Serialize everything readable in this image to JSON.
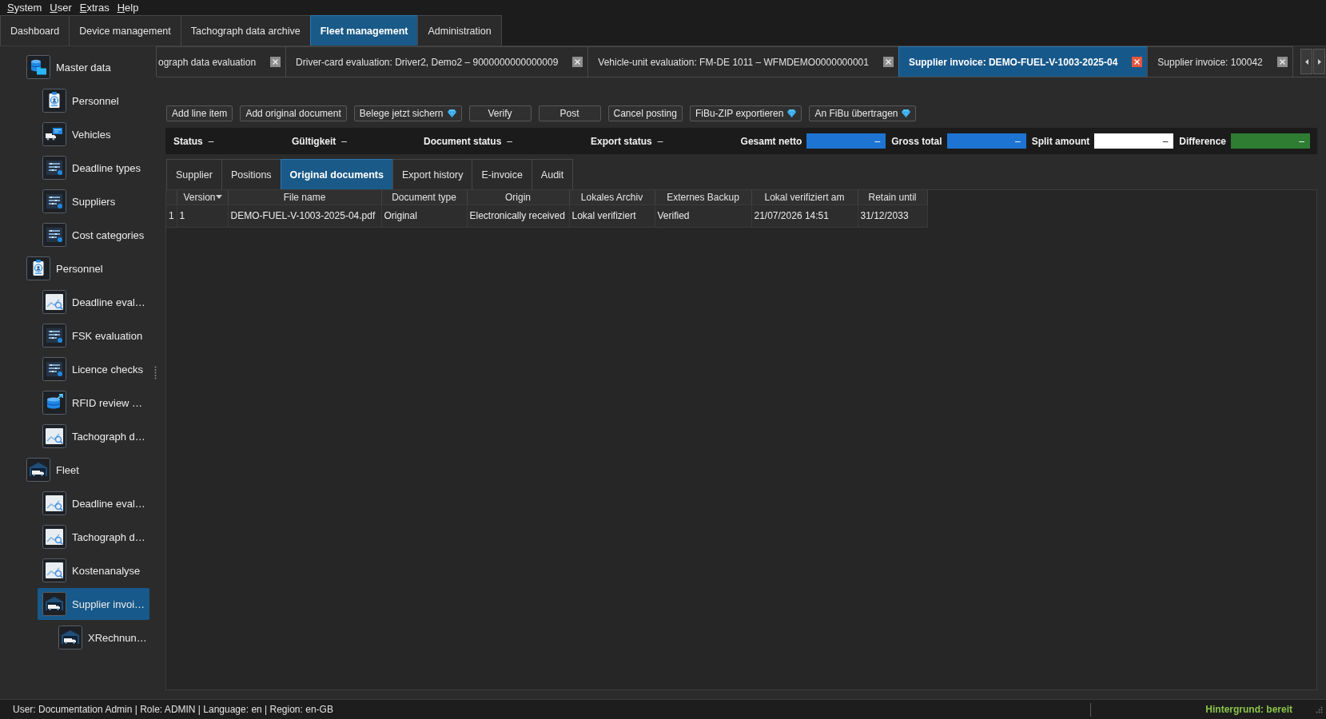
{
  "menu_bar": {
    "items": [
      "System",
      "User",
      "Extras",
      "Help"
    ]
  },
  "main_tabs": [
    {
      "label": "Dashboard",
      "selected": false
    },
    {
      "label": "Device management",
      "selected": false
    },
    {
      "label": "Tachograph data archive",
      "selected": false
    },
    {
      "label": "Fleet management",
      "selected": true
    },
    {
      "label": "Administration",
      "selected": false
    }
  ],
  "sidebar": {
    "items": [
      {
        "label": "Master data",
        "kind": "database",
        "selected": false,
        "children": [
          {
            "label": "Personnel",
            "kind": "badge",
            "selected": false
          },
          {
            "label": "Vehicles",
            "kind": "vehicles",
            "selected": false
          },
          {
            "label": "Deadline types",
            "kind": "list",
            "selected": false
          },
          {
            "label": "Suppliers",
            "kind": "list",
            "selected": false
          },
          {
            "label": "Cost categories",
            "kind": "list",
            "selected": false
          }
        ]
      },
      {
        "label": "Personnel",
        "kind": "badge",
        "selected": false,
        "children": [
          {
            "label": "Deadline eval…",
            "kind": "chart",
            "selected": false
          },
          {
            "label": "FSK evaluation",
            "kind": "list",
            "selected": false
          },
          {
            "label": "Licence checks",
            "kind": "list",
            "selected": false
          },
          {
            "label": "RFID review …",
            "kind": "export",
            "selected": false
          },
          {
            "label": "Tachograph d…",
            "kind": "chart",
            "selected": false
          }
        ]
      },
      {
        "label": "Fleet",
        "kind": "fleet",
        "selected": false,
        "children": [
          {
            "label": "Deadline eval…",
            "kind": "chart",
            "selected": false
          },
          {
            "label": "Tachograph d…",
            "kind": "chart",
            "selected": false
          },
          {
            "label": "Kostenanalyse",
            "kind": "chart",
            "selected": false
          },
          {
            "label": "Supplier invoi…",
            "kind": "fleet",
            "selected": true,
            "children": [
              {
                "label": "XRechnun…",
                "kind": "fleet",
                "selected": false
              }
            ]
          }
        ]
      }
    ]
  },
  "document_tabs": [
    {
      "label": "ograph data evaluation",
      "selected": false
    },
    {
      "label": "Driver-card evaluation: Driver2, Demo2 – 9000000000000009",
      "selected": false
    },
    {
      "label": "Vehicle-unit evaluation: FM-DE 1011 – WFMDEMO0000000001",
      "selected": false
    },
    {
      "label": "Supplier invoice: DEMO-FUEL-V-1003-2025-04",
      "selected": true
    },
    {
      "label": "Supplier invoice: 100042",
      "selected": false
    }
  ],
  "toolbar": {
    "buttons": [
      {
        "label": "Add line item",
        "kind": "plain"
      },
      {
        "label": "Add original document",
        "kind": "plain"
      },
      {
        "label": "Belege jetzt sichern",
        "kind": "premium"
      },
      {
        "label": "Verify",
        "kind": "plain"
      },
      {
        "label": "Post",
        "kind": "plain"
      },
      {
        "label": "Cancel posting",
        "kind": "plain"
      },
      {
        "label": "FiBu-ZIP exportieren",
        "kind": "premium"
      },
      {
        "label": "An FiBu übertragen",
        "kind": "premium"
      }
    ]
  },
  "status_row": {
    "fields": [
      {
        "label": "Status",
        "value": "–"
      },
      {
        "label": "Gültigkeit",
        "value": "–"
      },
      {
        "label": "Document status",
        "value": "–"
      },
      {
        "label": "Export status",
        "value": "–"
      }
    ],
    "totals": [
      {
        "label": "Gesamt netto",
        "value": "–",
        "color": "#1e74d2"
      },
      {
        "label": "Gross total",
        "value": "–",
        "color": "#1e74d2"
      },
      {
        "label": "Split amount",
        "value": "–",
        "color": "#ffffff"
      },
      {
        "label": "Difference",
        "value": "–",
        "color": "#2e7d32"
      }
    ]
  },
  "detail_tabs": [
    {
      "label": "Supplier",
      "selected": false
    },
    {
      "label": "Positions",
      "selected": false
    },
    {
      "label": "Original documents",
      "selected": true
    },
    {
      "label": "Export history",
      "selected": false
    },
    {
      "label": "E-invoice",
      "selected": false
    },
    {
      "label": "Audit",
      "selected": false
    }
  ],
  "table": {
    "columns": [
      {
        "label": "Version",
        "sorted": true
      },
      {
        "label": "File name",
        "sorted": false
      },
      {
        "label": "Document type",
        "sorted": false
      },
      {
        "label": "Origin",
        "sorted": false
      },
      {
        "label": "Lokales Archiv",
        "sorted": false
      },
      {
        "label": "Externes Backup",
        "sorted": false
      },
      {
        "label": "Lokal verifiziert am",
        "sorted": false
      },
      {
        "label": "Retain until",
        "sorted": false
      }
    ],
    "rows": [
      {
        "row_number": "1",
        "cells": [
          "1",
          "DEMO-FUEL-V-1003-2025-04.pdf",
          "Original",
          "Electronically received",
          "Lokal verifiziert",
          "Verified",
          "21/07/2026 14:51",
          "31/12/2033"
        ]
      }
    ]
  },
  "status_bar": {
    "session_info": "User: Documentation Admin | Role: ADMIN | Language: en | Region: en-GB",
    "background_task": "Hintergrund: bereit"
  }
}
